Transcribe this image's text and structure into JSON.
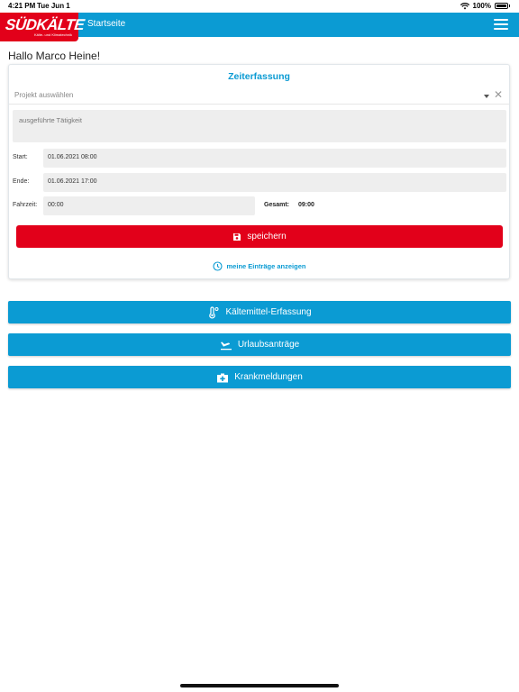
{
  "status_bar": {
    "time": "4:21 PM",
    "date": "Tue Jun 1",
    "battery": "100%"
  },
  "app_bar": {
    "logo_text": "SÜDKÄLTE",
    "logo_subtext": "Kälte- und Klimatechnik",
    "title": "Startseite",
    "menu_icon": "hamburger-icon"
  },
  "greeting": "Hallo Marco Heine!",
  "time_entry": {
    "title": "Zeiterfassung",
    "project_placeholder": "Projekt auswählen",
    "activity_placeholder": "ausgeführte Tätigkeit",
    "start_label": "Start:",
    "start_value": "01.06.2021 08:00",
    "end_label": "Ende:",
    "end_value": "01.06.2021 17:00",
    "travel_label": "Fahrzeit:",
    "travel_value": "00:00",
    "total_label": "Gesamt:",
    "total_value": "09:00",
    "save_label": "speichern",
    "entries_link": "meine Einträge anzeigen"
  },
  "actions": [
    {
      "label": "Kältemittel-Erfassung",
      "icon": "thermometer-icon"
    },
    {
      "label": "Urlaubsanträge",
      "icon": "plane-icon"
    },
    {
      "label": "Krankmeldungen",
      "icon": "medical-kit-icon"
    }
  ],
  "colors": {
    "primary": "#0b9bd3",
    "accent": "#e2001a",
    "field_bg": "#eeeeee"
  }
}
